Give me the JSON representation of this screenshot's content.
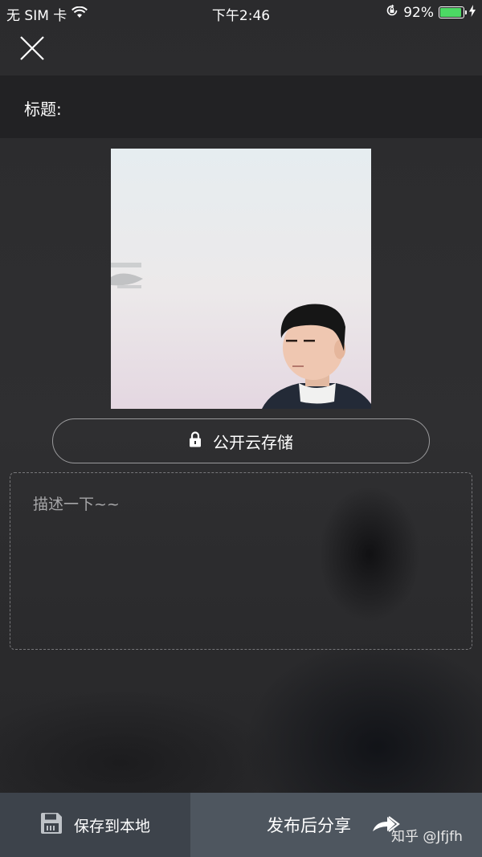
{
  "status_bar": {
    "carrier": "无 SIM 卡",
    "time": "下午2:46",
    "battery": "92%",
    "battery_level": 0.92,
    "battery_color": "#4cd964"
  },
  "header": {
    "close_icon": "close-icon"
  },
  "title_field": {
    "label": "标题:",
    "value": ""
  },
  "image": {
    "icon": "photo-thumbnail"
  },
  "storage": {
    "label": "公开云存储",
    "icon": "lock-icon"
  },
  "description": {
    "placeholder": "描述一下~~",
    "value": ""
  },
  "bottom_bar": {
    "save_label": "保存到本地",
    "save_icon": "floppy-disk-icon",
    "publish_label": "发布后分享",
    "publish_icon": "share-arrow-icon",
    "watermark": "知乎 @Jfjfh"
  },
  "colors": {
    "background": "#2a2a2c",
    "title_bar": "#222224",
    "save_button": "#3d434b",
    "publish_button": "#4e565f"
  }
}
